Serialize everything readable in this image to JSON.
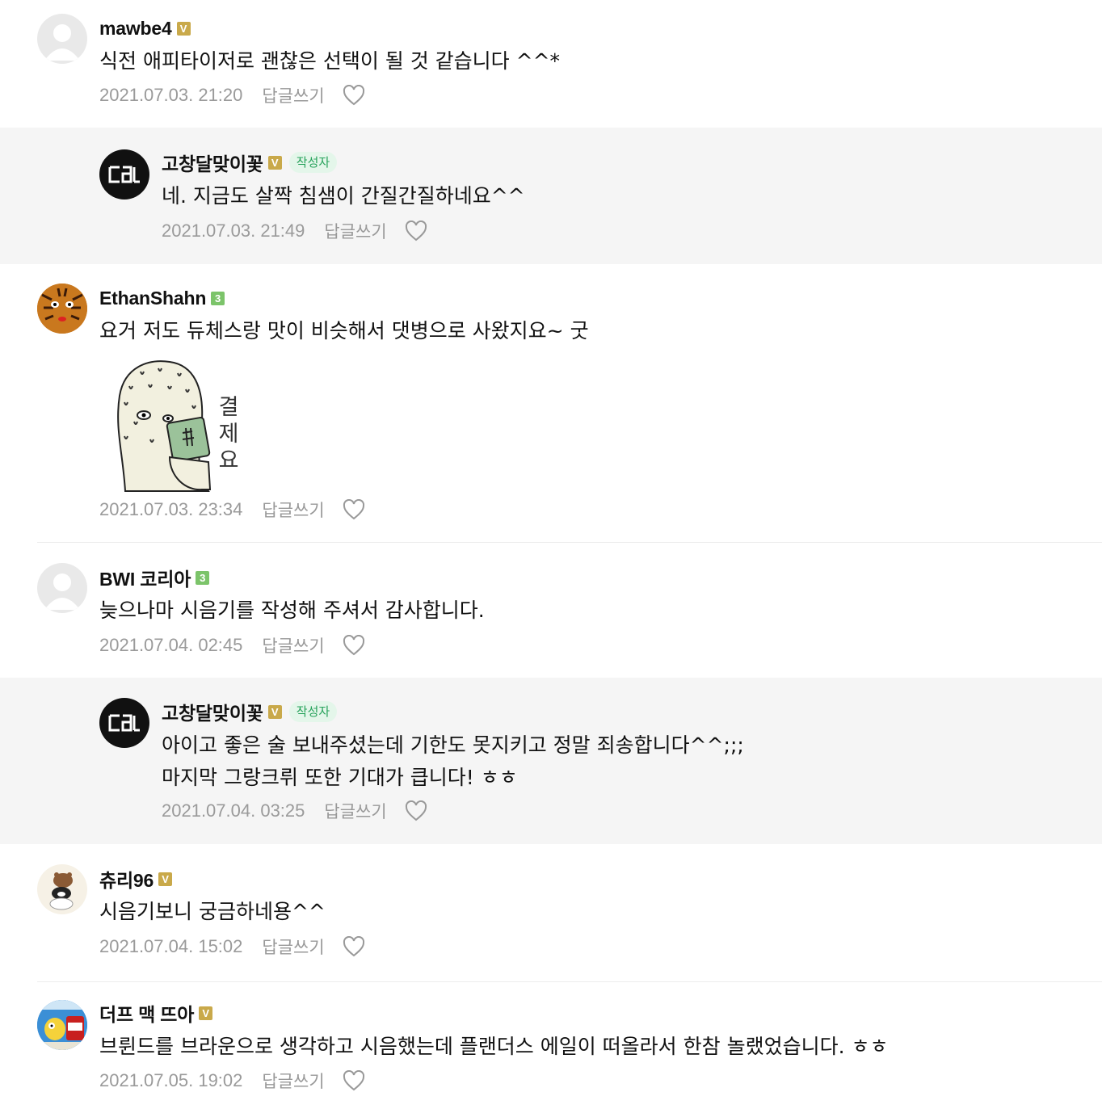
{
  "comments": [
    {
      "nick": "mawbe4",
      "badge": "V",
      "text": "식전 애피타이저로 괜찮은 선택이 될 것 같습니다 ^^*",
      "date": "2021.07.03. 21:20",
      "reply_label": "답글쓰기"
    },
    {
      "nick": "고창달맞이꽃",
      "badge": "V",
      "author_tag": "작성자",
      "text": "네. 지금도 살짝 침샘이 간질간질하네요^^",
      "date": "2021.07.03. 21:49",
      "reply_label": "답글쓰기"
    },
    {
      "nick": "EthanShahn",
      "badge": "3",
      "text": "요거 저도 듀체스랑 맛이 비슷해서 댓병으로 사왔지요~ 굿",
      "sticker_text": [
        "결",
        "제",
        "요"
      ],
      "date": "2021.07.03. 23:34",
      "reply_label": "답글쓰기"
    },
    {
      "nick": "BWI 코리아",
      "badge": "3",
      "text": "늦으나마 시음기를 작성해 주셔서 감사합니다.",
      "date": "2021.07.04. 02:45",
      "reply_label": "답글쓰기"
    },
    {
      "nick": "고창달맞이꽃",
      "badge": "V",
      "author_tag": "작성자",
      "text": "아이고 좋은 술 보내주셨는데 기한도 못지키고 정말 죄송합니다^^;;;",
      "text2": "마지막 그랑크뤼 또한 기대가 큽니다! ㅎㅎ",
      "date": "2021.07.04. 03:25",
      "reply_label": "답글쓰기"
    },
    {
      "nick": "츄리96",
      "badge": "V",
      "text": "시음기보니 궁금하네용^^",
      "date": "2021.07.04. 15:02",
      "reply_label": "답글쓰기"
    },
    {
      "nick": "더프 맥 뜨아",
      "badge": "V",
      "text": "브륀드를 브라운으로 생각하고 시음했는데 플랜더스 에일이 떠올라서 한참 놀랬었습니다. ㅎㅎ",
      "date": "2021.07.05. 19:02",
      "reply_label": "답글쓰기"
    }
  ],
  "colors": {
    "badge_gold": "#c9a94a",
    "badge_green": "#7cc46a",
    "author_tag_text": "#26a25a",
    "reply_bg": "#f5f5f5",
    "meta_text": "#999999"
  }
}
